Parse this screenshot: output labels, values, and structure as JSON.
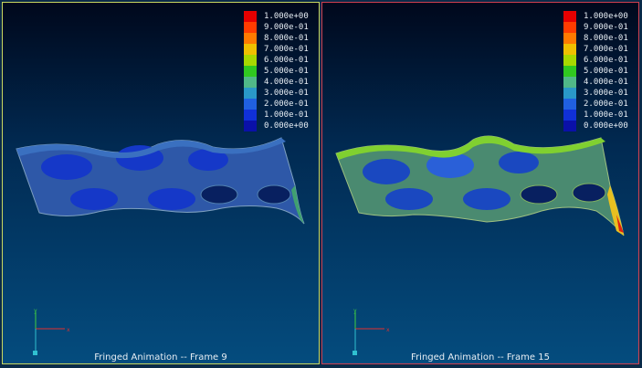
{
  "legend": {
    "labels": [
      "1.000e+00",
      "9.000e-01",
      "8.000e-01",
      "7.000e-01",
      "6.000e-01",
      "5.000e-01",
      "4.000e-01",
      "3.000e-01",
      "2.000e-01",
      "1.000e-01",
      "0.000e+00"
    ],
    "colors": [
      "#e60000",
      "#ff3c00",
      "#ff7a00",
      "#f0c000",
      "#a8d800",
      "#30c820",
      "#50b888",
      "#2a98c8",
      "#2060e0",
      "#1030d8",
      "#0a10a8"
    ]
  },
  "viewports": [
    {
      "id": "left",
      "caption": "Fringed Animation -- Frame 9",
      "frame": 9
    },
    {
      "id": "right",
      "caption": "Fringed Animation -- Frame 15",
      "frame": 15
    }
  ],
  "triad": {
    "x_label": "x",
    "y_label": "y",
    "z_label": "z"
  }
}
